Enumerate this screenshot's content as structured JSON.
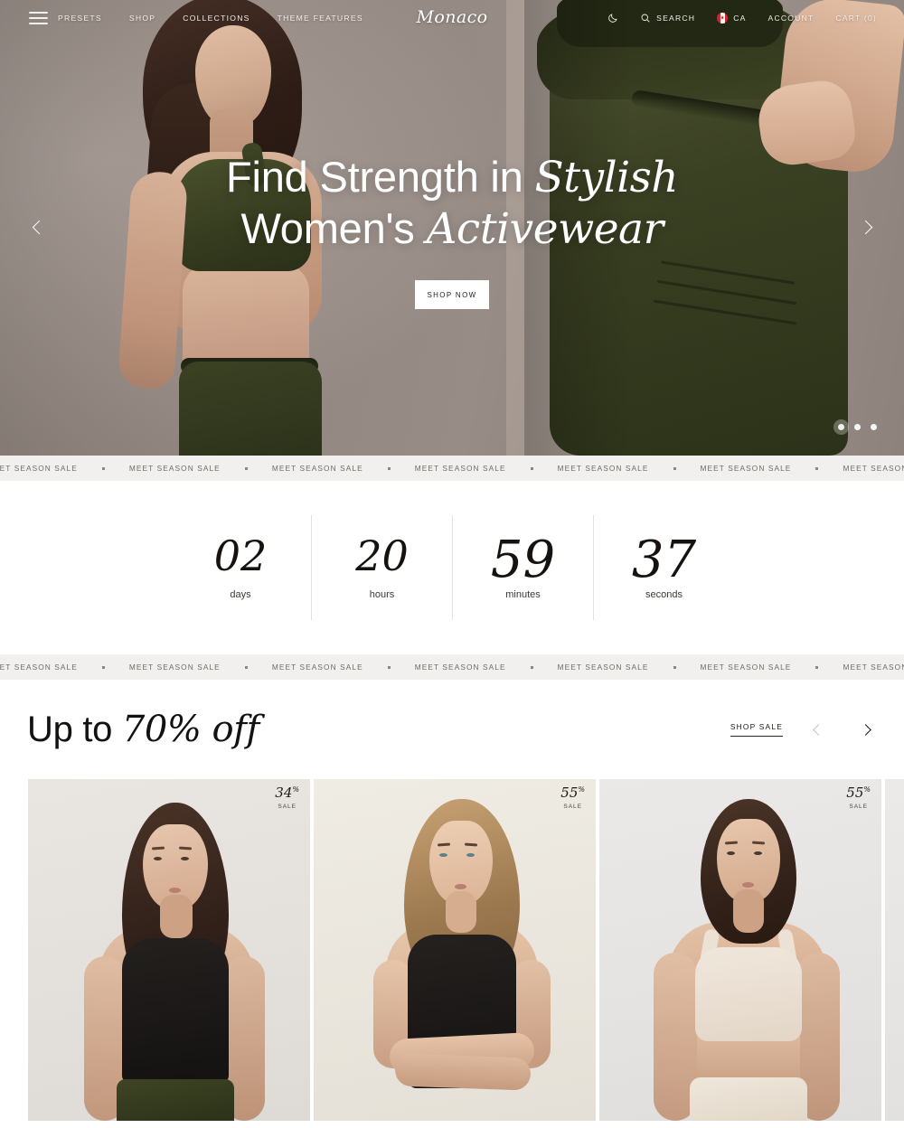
{
  "header": {
    "menu_icon": "hamburger-icon",
    "nav": [
      {
        "label": "PRESETS"
      },
      {
        "label": "SHOP"
      },
      {
        "label": "COLLECTIONS"
      },
      {
        "label": "THEME FEATURES"
      }
    ],
    "logo": "Monaco",
    "dark_mode_icon": "moon-icon",
    "search": {
      "icon": "search-icon",
      "label": "SEARCH"
    },
    "locale": {
      "icon": "canada-flag-icon",
      "label": "CA"
    },
    "account_label": "ACCOUNT",
    "cart_label": "CART (0)"
  },
  "hero": {
    "title_line1_plain": "Find Strength in ",
    "title_line1_italic": "Stylish",
    "title_line2_plain": "Women's ",
    "title_line2_italic": "Activewear",
    "cta_label": "SHOP NOW",
    "prev_icon": "chevron-left-icon",
    "next_icon": "chevron-right-icon",
    "slide_count": 3,
    "active_slide": 1,
    "background_color": "#9a908b"
  },
  "marquee": {
    "text": "MEET SEASON SALE",
    "separator": "•",
    "repeat": 11,
    "background_color": "#f1f0ee",
    "text_color": "#6f6b66"
  },
  "countdown": {
    "units": [
      {
        "value": "02",
        "label": "days",
        "size": "sm"
      },
      {
        "value": "20",
        "label": "hours",
        "size": "sm"
      },
      {
        "value": "59",
        "label": "minutes",
        "size": "lg"
      },
      {
        "value": "37",
        "label": "seconds",
        "size": "lg"
      }
    ]
  },
  "sale": {
    "title_plain": "Up to ",
    "title_italic": "70% off",
    "shop_link_label": "SHOP SALE",
    "prev_icon": "chevron-left-icon",
    "next_icon": "chevron-right-icon",
    "prev_disabled": true,
    "products": [
      {
        "discount": "34",
        "percent_symbol": "%",
        "badge_label": "SALE",
        "image": "model-black-tank-brunette"
      },
      {
        "discount": "55",
        "percent_symbol": "%",
        "badge_label": "SALE",
        "image": "model-black-tank-blonde"
      },
      {
        "discount": "55",
        "percent_symbol": "%",
        "badge_label": "SALE",
        "image": "model-cream-bra-brunette"
      }
    ]
  }
}
